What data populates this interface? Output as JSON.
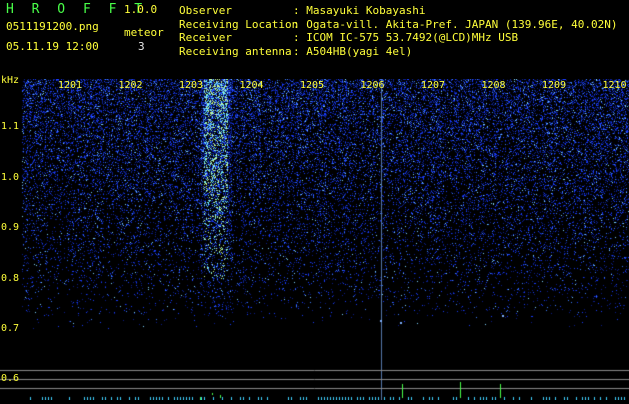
{
  "header": {
    "logo": "H R O F F T",
    "version": "1.0.0",
    "filename": "0511191200.png",
    "datetime": "05.11.19 12:00",
    "meteor_label": "meteor",
    "meteor_count": "3"
  },
  "info": [
    {
      "label": "Observer",
      "value": ": Masayuki Kobayashi"
    },
    {
      "label": "Receiving Location",
      "value": ": Ogata-vill. Akita-Pref. JAPAN (139.96E, 40.02N)"
    },
    {
      "label": "Receiver",
      "value": ": ICOM IC-575 53.7492(@LCD)MHz USB"
    },
    {
      "label": "Receiving antenna",
      "value": ": A504HB(yagi 4el)"
    }
  ],
  "spectrogram": {
    "y_unit": "kHz",
    "y_ticks": [
      "1.1",
      "1.0",
      "0.9",
      "0.8",
      "0.7",
      "0.6"
    ],
    "x_ticks": [
      "1201",
      "1202",
      "1203",
      "1204",
      "1205",
      "1206",
      "1207",
      "1208",
      "1209",
      "1210"
    ],
    "colors": {
      "background": "#000000",
      "noise": "#1a3cff",
      "label": "#ffff3a",
      "marker": "#49ff49"
    }
  }
}
